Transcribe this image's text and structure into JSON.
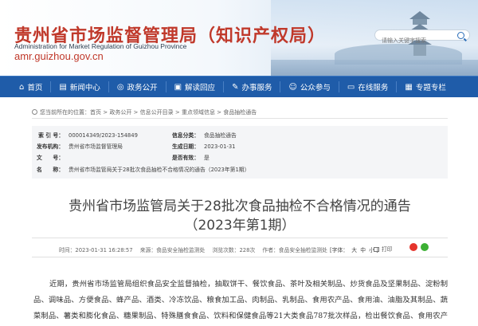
{
  "header": {
    "logo_cn": "贵州省市场监督管理局（知识产权局）",
    "logo_en": "Administration for Market Regulation of Guizhou Province",
    "logo_url": "amr.guizhou.gov.cn",
    "search_placeholder": "请输入关键字搜索",
    "brand_color": "#c0392b"
  },
  "nav": {
    "bg_color": "#1f5ca9",
    "items": [
      {
        "label": "首页",
        "icon": "home-icon",
        "glyph": "⌂"
      },
      {
        "label": "新闻中心",
        "icon": "news-icon",
        "glyph": "▤"
      },
      {
        "label": "政务公开",
        "icon": "gov-open-icon",
        "glyph": "◎"
      },
      {
        "label": "解读回应",
        "icon": "interpret-icon",
        "glyph": "▣"
      },
      {
        "label": "办事服务",
        "icon": "service-icon",
        "glyph": "✎"
      },
      {
        "label": "公众参与",
        "icon": "public-icon",
        "glyph": "☺"
      },
      {
        "label": "在线服务",
        "icon": "online-icon",
        "glyph": "▭"
      },
      {
        "label": "专题专栏",
        "icon": "topic-icon",
        "glyph": "▦"
      }
    ]
  },
  "breadcrumb": {
    "text": "您当前所在的位置：首页 > 政务公开 > 信息公开目录 > 重点领域信息 > 食品抽检通告"
  },
  "info": {
    "index_label": "索 引 号：",
    "index_value": "000014349/2023-154849",
    "category_label": "信息分类：",
    "category_value": "食品抽检通告",
    "issuer_label": "发布机构：",
    "issuer_value": "贵州省市场监督管理局",
    "date_label": "生成日期：",
    "date_value": "2023-01-31",
    "docno_label": "文　　号：",
    "docno_value": "",
    "valid_label": "是否有效：",
    "valid_value": "是",
    "name_label": "名　　称：",
    "name_value": "贵州省市场监管局关于28批次食品抽检不合格情况的通告（2023年第1期）"
  },
  "article": {
    "title_line1": "贵州省市场监管局关于28批次食品抽检不合格情况的通告",
    "title_line2": "（2023年第1期）",
    "time": "时间：2023-01-31 16:28:57",
    "source": "来源：食品安全抽检监测处",
    "views": "浏览次数：228次",
    "author": "作者：食品安全抽检监测处",
    "font_label": "[字体：",
    "font_large": "大",
    "font_medium": "中",
    "font_small": "小",
    "font_close": "]",
    "print": "打印",
    "body": "近期，贵州省市场监管局组织食品安全监督抽检，抽取饼干、餐饮食品、茶叶及相关制品、炒货食品及坚果制品、淀粉制品、调味品、方便食品、蜂产品、酒类、冷冻饮品、粮食加工品、肉制品、乳制品、食用农产品、食用油、油脂及其制品、蔬菜制品、薯类和膨化食品、糖果制品、特殊膳食食品、饮料和保健食品等21大类食品787批次样品，检出餐饮食品、食用农产品、"
  }
}
